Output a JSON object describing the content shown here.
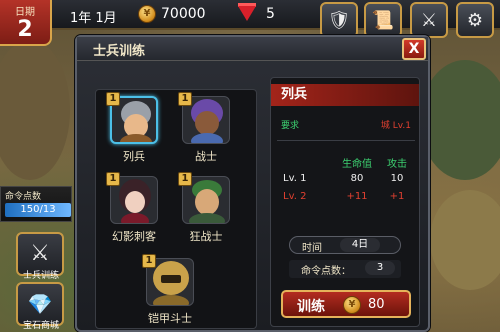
{
  "topbar": {
    "date_label": "日期",
    "date_value": "2",
    "year_month": "1年 1月",
    "gold": "70000",
    "gems": "5"
  },
  "dialog": {
    "title": "士兵训练",
    "close": "X"
  },
  "units": [
    {
      "name": "列兵",
      "level": "1",
      "selected": true
    },
    {
      "name": "战士",
      "level": "1",
      "selected": false
    },
    {
      "name": "幻影刺客",
      "level": "1",
      "selected": false
    },
    {
      "name": "狂战士",
      "level": "1",
      "selected": false
    },
    {
      "name": "铠甲斗士",
      "level": "1",
      "selected": false
    }
  ],
  "info": {
    "title": "列兵",
    "requirement_label": "要求",
    "requirement_value": "城 Lv.1",
    "stat_headers": [
      "生命值",
      "攻击"
    ],
    "rows": [
      {
        "level": "Lv. 1",
        "hp": "80",
        "atk": "10"
      },
      {
        "level": "Lv. 2",
        "hp": "+11",
        "atk": "+1"
      }
    ],
    "time_label": "时间",
    "time_value": "4日",
    "cmd_label": "命令点数：",
    "cmd_value": "3",
    "train_label": "训练",
    "train_cost": "80"
  },
  "sidebar": {
    "cmd_points_label": "命令点数",
    "cmd_points_value": "150/13",
    "buttons": [
      "士兵训练",
      "宝石商城"
    ]
  },
  "colors": {
    "accent_red": "#b32c20",
    "green_text": "#3cd070",
    "red_text": "#e04030",
    "gold_border": "#e5b25a",
    "selection": "#4cc0e8"
  }
}
